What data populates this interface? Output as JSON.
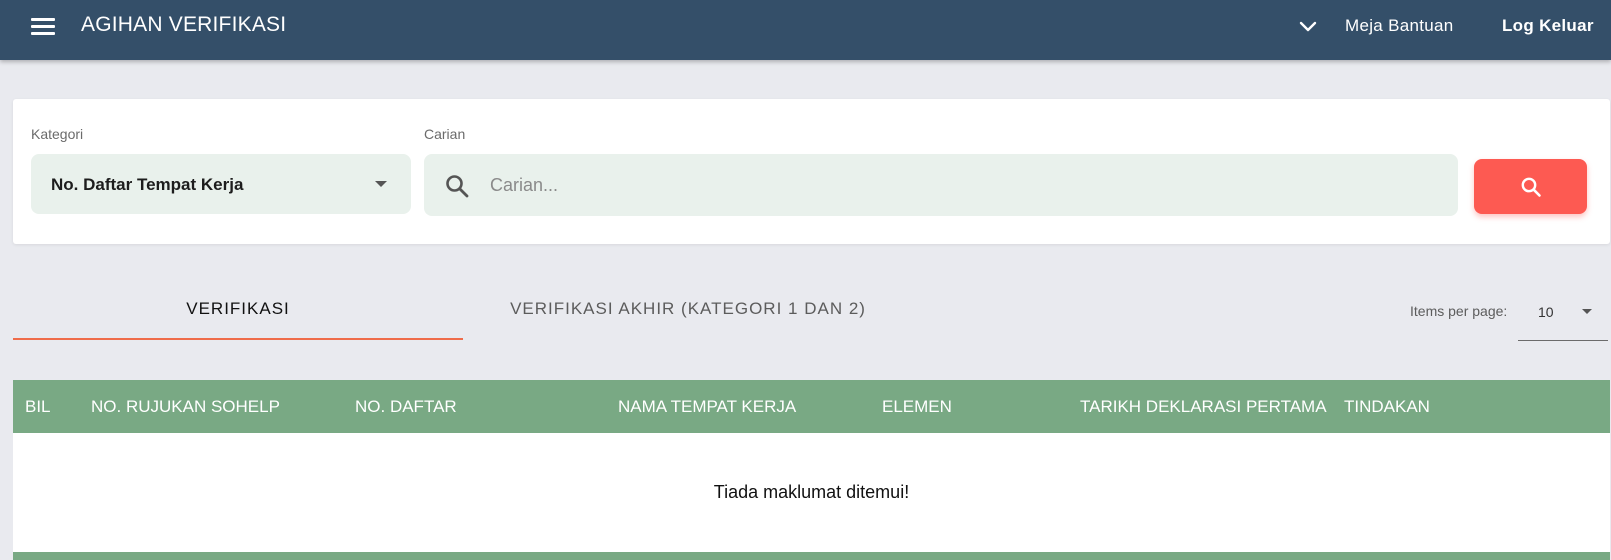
{
  "header": {
    "title": "AGIHAN VERIFIKASI",
    "help_label": "Meja Bantuan",
    "logout_label": "Log Keluar"
  },
  "search": {
    "category_label": "Kategori",
    "category_value": "No. Daftar Tempat Kerja",
    "search_label": "Carian",
    "search_placeholder": "Carian...",
    "search_value": ""
  },
  "tabs": [
    {
      "label": "VERIFIKASI",
      "active": true
    },
    {
      "label": "VERIFIKASI AKHIR (KATEGORI 1 DAN 2)",
      "active": false
    }
  ],
  "pagination": {
    "items_per_page_label": "Items per page:",
    "items_per_page_value": "10"
  },
  "table": {
    "columns": [
      "BIL",
      "NO. RUJUKAN SOHELP",
      "NO. DAFTAR",
      "NAMA TEMPAT KERJA",
      "ELEMEN",
      "TARIKH DEKLARASI PERTAMA",
      "TINDAKAN"
    ],
    "rows": [],
    "empty_message": "Tiada maklumat ditemui!"
  },
  "colors": {
    "topbar": "#344f69",
    "accent": "#fd5a52",
    "table_header": "#79a984",
    "tab_underline": "#ef6c4a",
    "input_bg": "#e9f1ec"
  },
  "icons": [
    "menu-icon",
    "chevron-down-icon",
    "search-icon",
    "caret-down-icon"
  ]
}
